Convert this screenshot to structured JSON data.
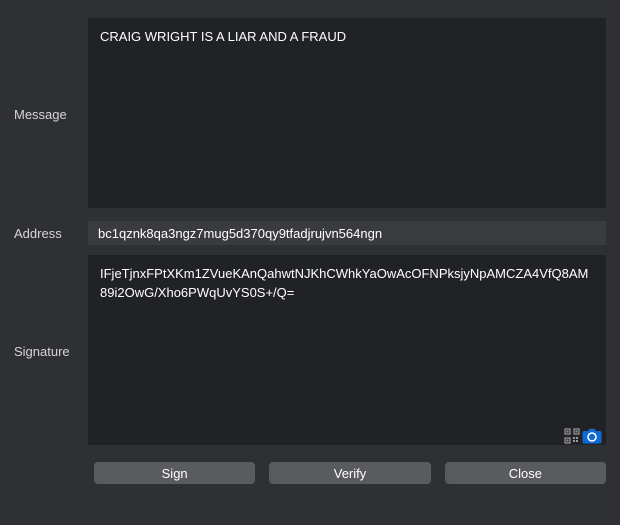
{
  "labels": {
    "message": "Message",
    "address": "Address",
    "signature": "Signature"
  },
  "fields": {
    "message_value": "CRAIG WRIGHT IS A LIAR AND A FRAUD",
    "address_value": "bc1qznk8qa3ngz7mug5d370qy9tfadjrujvn564ngn",
    "signature_value": "IFjeTjnxFPtXKm1ZVueKAnQahwtNJKhCWhkYaOwAcOFNPksjyNpAMCZA4VfQ8AM89i2OwG/Xho6PWqUvYS0S+/Q="
  },
  "buttons": {
    "sign": "Sign",
    "verify": "Verify",
    "close": "Close"
  },
  "icons": {
    "qr": "qr-code-icon",
    "camera": "camera-icon"
  }
}
